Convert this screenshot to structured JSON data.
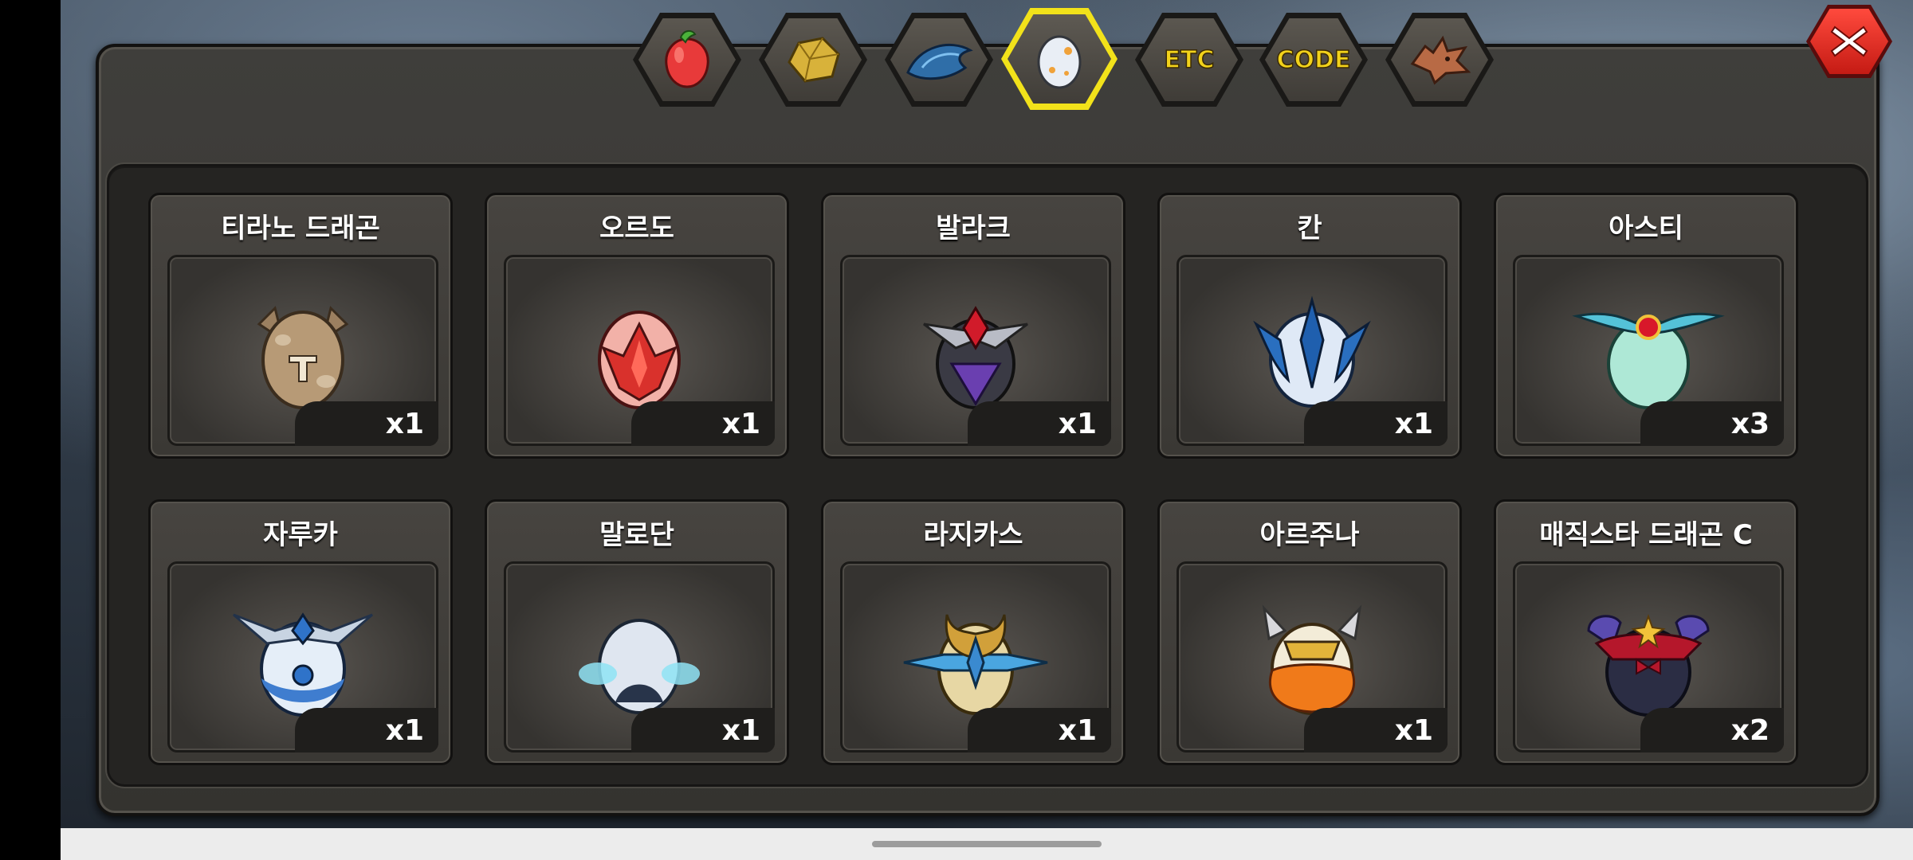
{
  "tabs": [
    {
      "name": "fruit-icon",
      "label": ""
    },
    {
      "name": "gold-ore-icon",
      "label": ""
    },
    {
      "name": "dragon-scale-icon",
      "label": ""
    },
    {
      "name": "egg-icon",
      "label": "",
      "active": true
    },
    {
      "name": "etc-tab",
      "label": "ETC"
    },
    {
      "name": "code-tab",
      "label": "CODE"
    },
    {
      "name": "dragon-head-icon",
      "label": ""
    }
  ],
  "close": {
    "icon": "close-icon"
  },
  "eggs": [
    {
      "name": "티라노 드래곤",
      "qty": "x1",
      "color": "#b79a76"
    },
    {
      "name": "오르도",
      "qty": "x1",
      "color": "#f0a39a"
    },
    {
      "name": "발라크",
      "qty": "x1",
      "color": "#3a3a44"
    },
    {
      "name": "칸",
      "qty": "x1",
      "color": "#dfe9f6"
    },
    {
      "name": "아스티",
      "qty": "x3",
      "color": "#aee8d6"
    },
    {
      "name": "자루카",
      "qty": "x1",
      "color": "#e5eef8"
    },
    {
      "name": "말로단",
      "qty": "x1",
      "color": "#dfe6f0"
    },
    {
      "name": "라지카스",
      "qty": "x1",
      "color": "#e7d7a4"
    },
    {
      "name": "아르주나",
      "qty": "x1",
      "color": "#f3ecd8"
    },
    {
      "name": "매직스타 드래곤 C",
      "qty": "x2",
      "color": "#2b2d44"
    }
  ]
}
